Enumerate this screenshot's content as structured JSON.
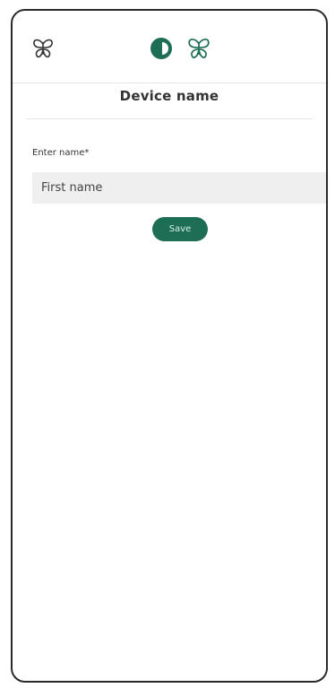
{
  "header": {
    "left_icon": "butterfly-logo-icon",
    "center_icon": "half-circle-theme-icon",
    "center_right_icon": "butterfly-logo-icon",
    "accent_color": "#1e6e55"
  },
  "page": {
    "title": "Device name"
  },
  "form": {
    "label": "Enter name*",
    "name_value": "",
    "name_placeholder": "First name",
    "save_label": "Save"
  }
}
